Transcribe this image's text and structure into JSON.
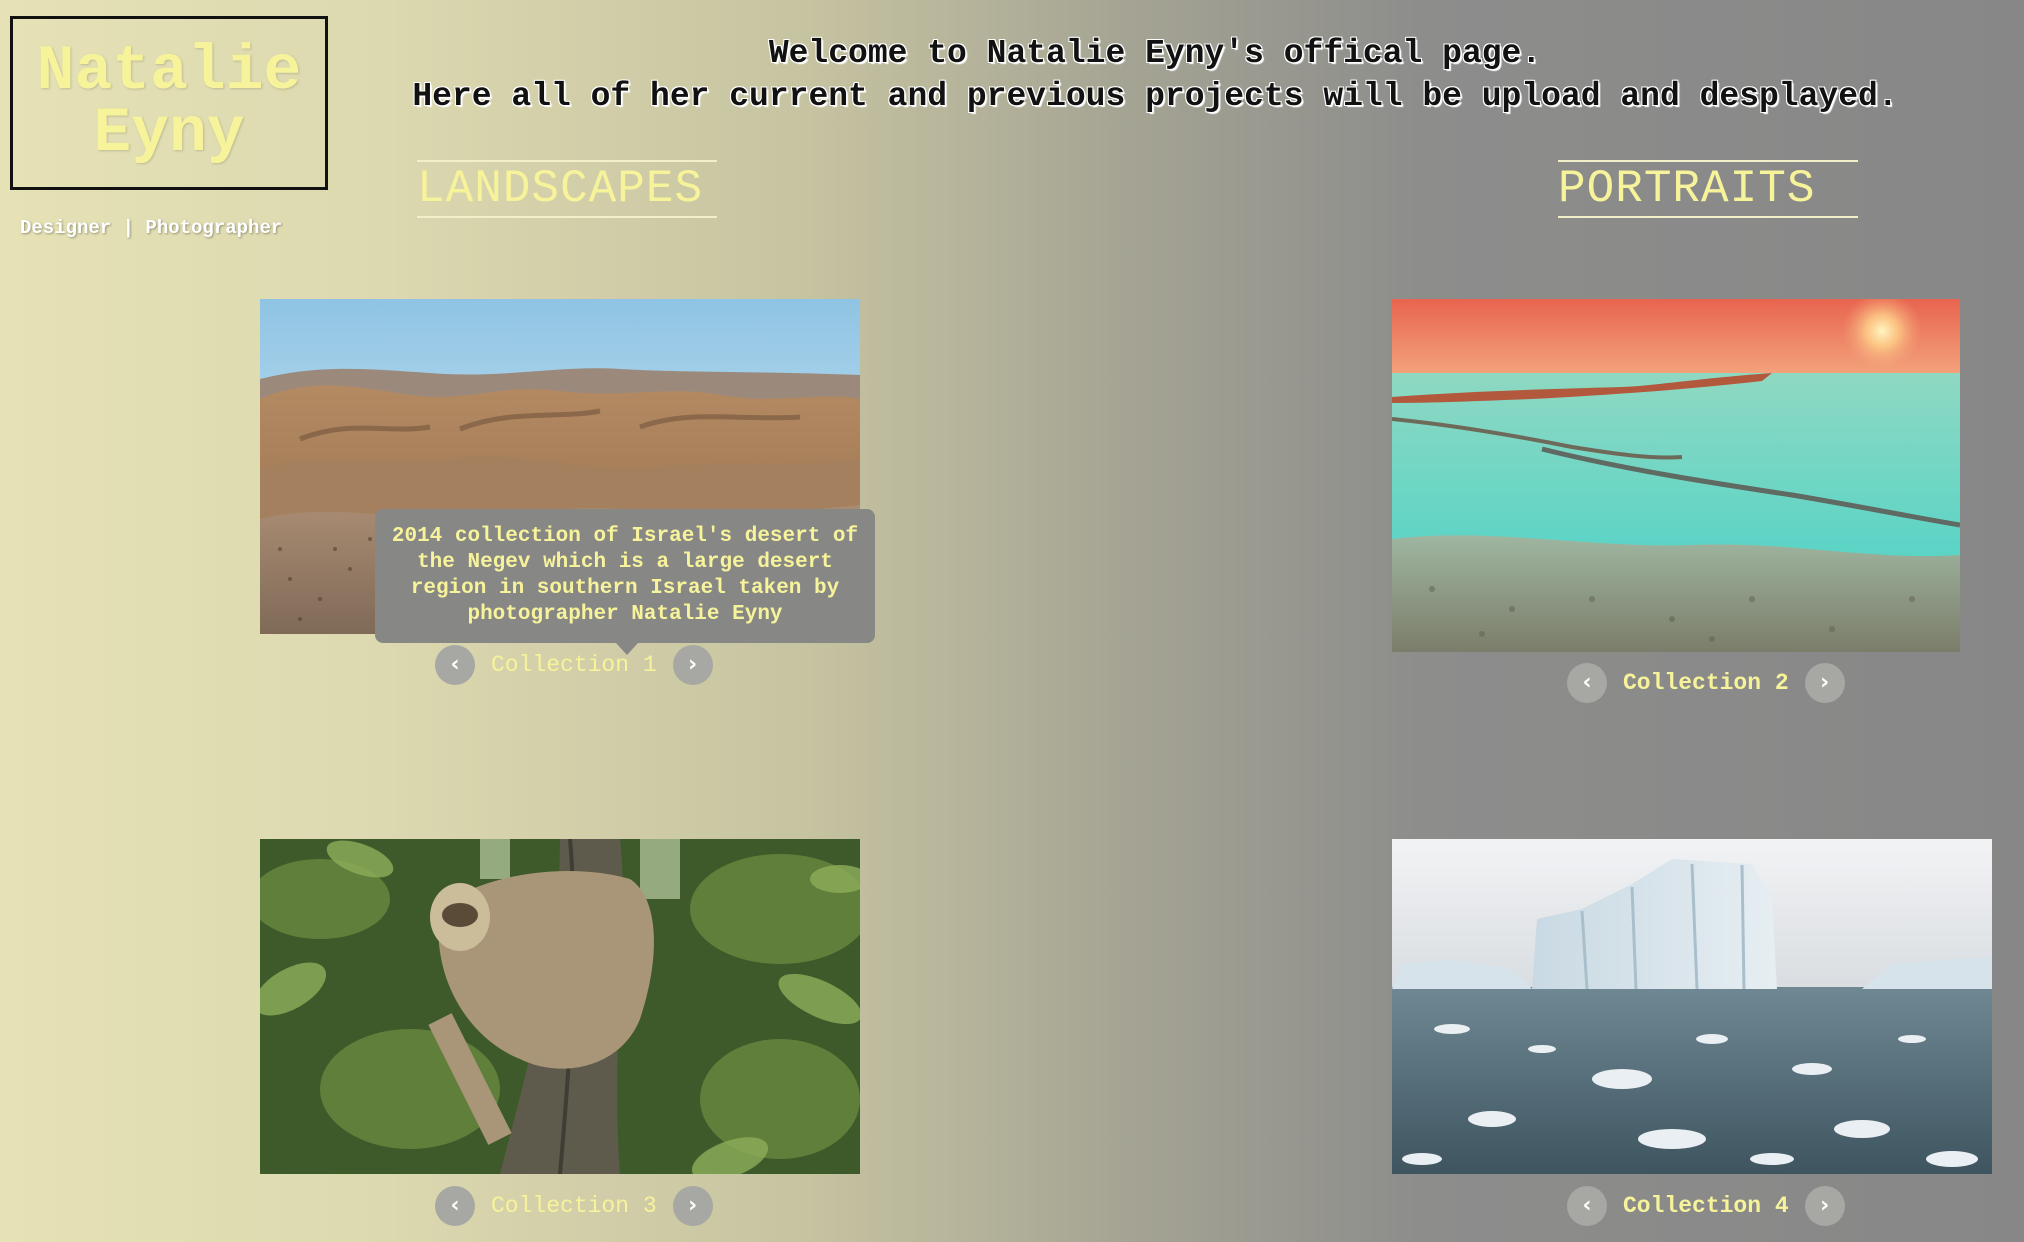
{
  "logo": {
    "line1": "Natalie",
    "line2": "Eyny",
    "tagline": "Designer | Photographer"
  },
  "welcome": {
    "line1": "Welcome to Natalie Eyny's offical page.",
    "line2": "Here all of her current and previous projects will be upload and desplayed."
  },
  "sections": {
    "landscapes": "LANDSCAPES",
    "portraits": "PORTRAITS"
  },
  "collections": [
    {
      "label": "Collection 1",
      "prev": "‹",
      "next": "›",
      "image": "desert-photo"
    },
    {
      "label": "Collection 2",
      "prev": "‹",
      "next": "›",
      "image": "salt-lake-sunset-photo"
    },
    {
      "label": "Collection 3",
      "prev": "‹",
      "next": "›",
      "image": "sloth-photo"
    },
    {
      "label": "Collection 4",
      "prev": "‹",
      "next": "›",
      "image": "iceberg-photo"
    }
  ],
  "tooltip": {
    "text": "2014 collection of Israel's desert of the Negev which is a large desert region in southern Israel taken by photographer Natalie Eyny"
  },
  "colors": {
    "accent_yellow": "#f7f39b",
    "tooltip_bg": "#878785",
    "arrow_bg": "#a7a7a3"
  }
}
